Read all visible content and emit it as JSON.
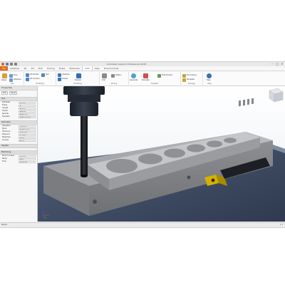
{
  "titlebar": {
    "title": "Autodesk Inventor Professional 2018"
  },
  "tabs": [
    {
      "label": "File",
      "kind": "file"
    },
    {
      "label": "Adaptive",
      "kind": "normal"
    },
    {
      "label": "2D",
      "kind": "normal"
    },
    {
      "label": "3D",
      "kind": "normal"
    },
    {
      "label": "Drill",
      "kind": "normal"
    },
    {
      "label": "Turning",
      "kind": "normal"
    },
    {
      "label": "Probe",
      "kind": "normal"
    },
    {
      "label": "Multi-Axis",
      "kind": "normal"
    },
    {
      "label": "CAM",
      "kind": "active"
    },
    {
      "label": "View",
      "kind": "normal"
    },
    {
      "label": "Environments",
      "kind": "normal"
    }
  ],
  "ribbon": {
    "groups": [
      {
        "name": "Job",
        "items": [
          "Setup",
          "Face",
          "Adaptive"
        ]
      },
      {
        "name": "2D Milling",
        "items": [
          "2D Pocket",
          "2D Contour",
          "Slot"
        ]
      },
      {
        "name": "3D Milling",
        "items": [
          "Adaptive",
          "Pocket",
          "Parallel"
        ]
      },
      {
        "name": "Drilling",
        "items": [
          "Drill",
          "Pattern"
        ]
      },
      {
        "name": "Toolpath",
        "items": [
          "Generate",
          "Simulate",
          "Post Process"
        ]
      },
      {
        "name": "Manage",
        "items": [
          "Tool Library",
          "Template"
        ]
      },
      {
        "name": "Help",
        "items": [
          "Help"
        ]
      }
    ]
  },
  "browser": {
    "title": "Properties",
    "toolbar": [
      "Edit",
      "Reset"
    ],
    "sections": [
      {
        "name": "Tool",
        "rows": [
          {
            "k": "Diameter",
            "v": "12 mm"
          },
          {
            "k": "Flutes",
            "v": "3"
          },
          {
            "k": "Length",
            "v": "50 mm"
          },
          {
            "k": "Holder",
            "v": "HSK 63"
          },
          {
            "k": "Spindle",
            "v": "8000 rpm"
          },
          {
            "k": "Feedrate",
            "v": "1500 mm/min"
          }
        ]
      },
      {
        "name": "Geometry",
        "rows": [
          {
            "k": "Operation",
            "v": "Adaptive"
          },
          {
            "k": "Stock",
            "v": "Relative box"
          },
          {
            "k": "Tolerance",
            "v": "0.01 mm"
          },
          {
            "k": "Stepover",
            "v": "1.2 mm"
          },
          {
            "k": "Stepdown",
            "v": "6 mm"
          },
          {
            "k": "Coolant",
            "v": "Flood"
          }
        ]
      },
      {
        "name": "Heights",
        "rows": []
      },
      {
        "name": "Machining",
        "rows": [
          {
            "k": "Stock to leave",
            "v": "0.3 mm"
          },
          {
            "k": "Ramp",
            "v": "Helix"
          },
          {
            "k": "Time",
            "v": "00:12:35"
          }
        ]
      }
    ]
  },
  "status": {
    "left": "Ready",
    "right": "1 1"
  }
}
